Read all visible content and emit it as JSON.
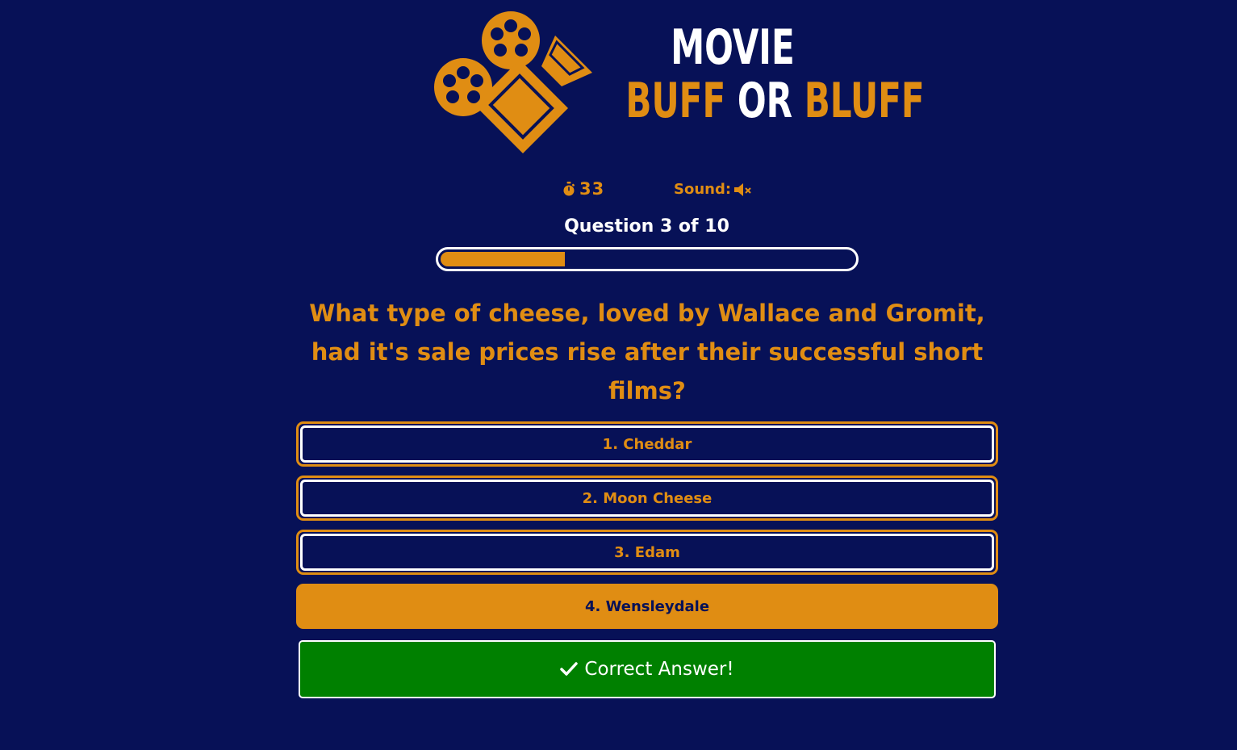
{
  "colors": {
    "background": "#071157",
    "accent": "#e08d13",
    "text": "#ffffff",
    "success": "#008000"
  },
  "logo": {
    "line1": "MOVIE",
    "line2_part1": "BUFF",
    "line2_part2": "OR",
    "line2_part3": "BLUFF",
    "icon": "movie-camera-icon"
  },
  "stats": {
    "timer_icon": "stopwatch-icon",
    "timer_value": "33",
    "sound_label": "Sound:",
    "sound_icon": "volume-mute-icon"
  },
  "progress": {
    "label": "Question 3 of 10",
    "current": 3,
    "total": 10,
    "fraction": 0.3
  },
  "question": {
    "text": "What type of cheese, loved by Wallace and Gromit, had it's sale prices rise after their successful short films?"
  },
  "answers": [
    {
      "label": "1. Cheddar",
      "selected": false
    },
    {
      "label": "2. Moon Cheese",
      "selected": false
    },
    {
      "label": "3. Edam",
      "selected": false
    },
    {
      "label": "4. Wensleydale",
      "selected": true
    }
  ],
  "feedback": {
    "icon": "checkmark-icon",
    "text": "Correct Answer!"
  }
}
